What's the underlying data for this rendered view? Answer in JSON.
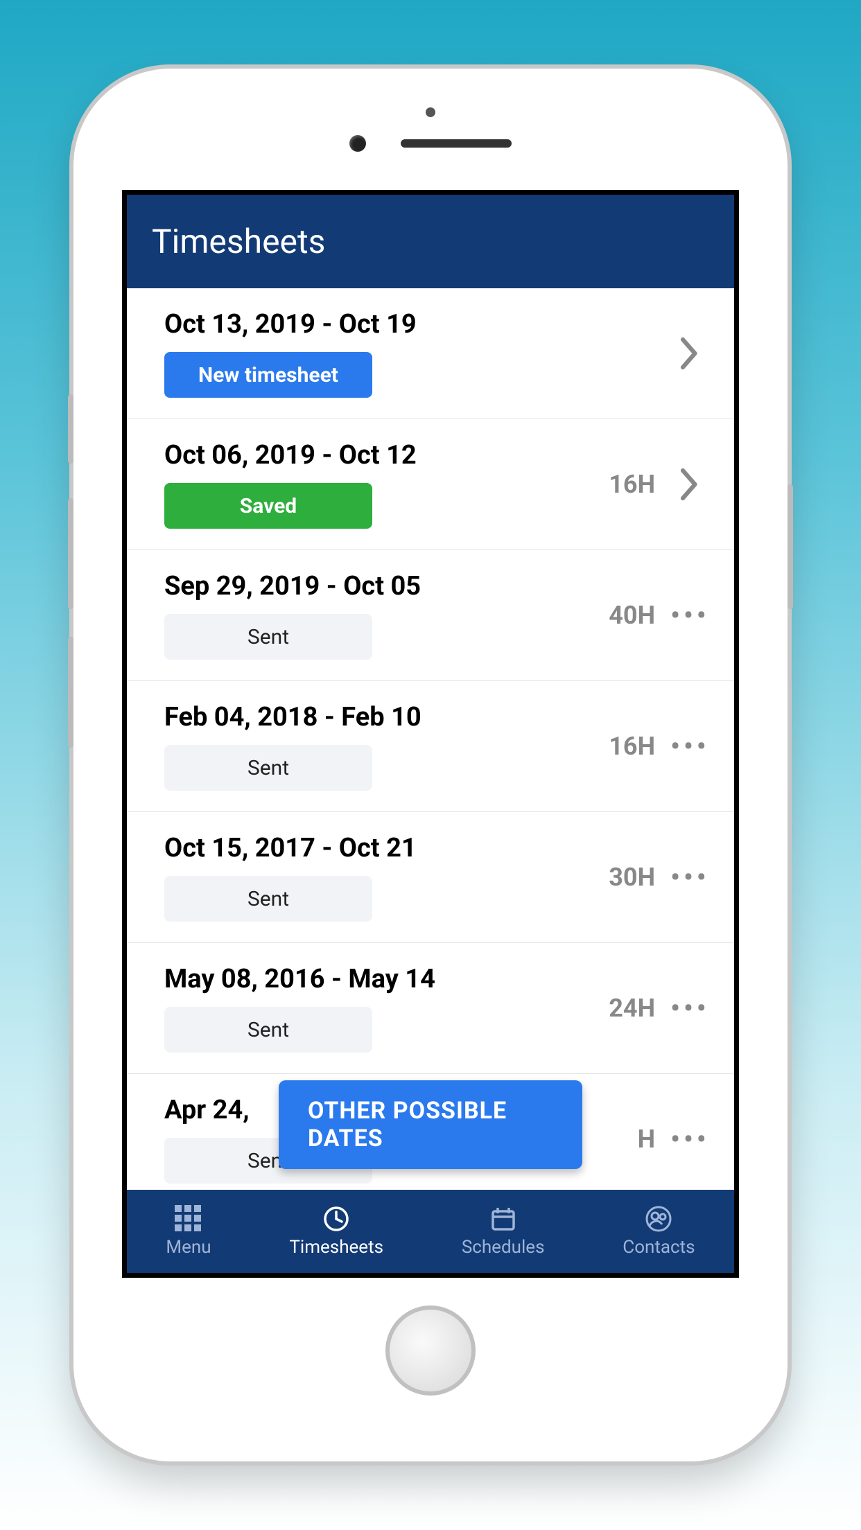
{
  "header": {
    "title": "Timesheets"
  },
  "rows": [
    {
      "date_range": "Oct 13, 2019 - Oct 19",
      "status": "New timesheet",
      "status_kind": "new",
      "hours": "",
      "action": "chevron"
    },
    {
      "date_range": "Oct 06, 2019 - Oct 12",
      "status": "Saved",
      "status_kind": "saved",
      "hours": "16H",
      "action": "chevron"
    },
    {
      "date_range": "Sep 29, 2019 - Oct 05",
      "status": "Sent",
      "status_kind": "sent",
      "hours": "40H",
      "action": "dots"
    },
    {
      "date_range": "Feb 04, 2018 - Feb 10",
      "status": "Sent",
      "status_kind": "sent",
      "hours": "16H",
      "action": "dots"
    },
    {
      "date_range": "Oct 15, 2017 - Oct 21",
      "status": "Sent",
      "status_kind": "sent",
      "hours": "30H",
      "action": "dots"
    },
    {
      "date_range": "May 08, 2016 - May 14",
      "status": "Sent",
      "status_kind": "sent",
      "hours": "24H",
      "action": "dots"
    },
    {
      "date_range": "Apr 24,",
      "status": "Sent",
      "status_kind": "sent",
      "hours": "H",
      "action": "dots"
    }
  ],
  "floating": {
    "label": "OTHER POSSIBLE DATES"
  },
  "tabs": [
    {
      "label": "Menu",
      "icon": "grid-icon",
      "active": false
    },
    {
      "label": "Timesheets",
      "icon": "clock-icon",
      "active": true
    },
    {
      "label": "Schedules",
      "icon": "calendar-icon",
      "active": false
    },
    {
      "label": "Contacts",
      "icon": "contacts-icon",
      "active": false
    }
  ]
}
